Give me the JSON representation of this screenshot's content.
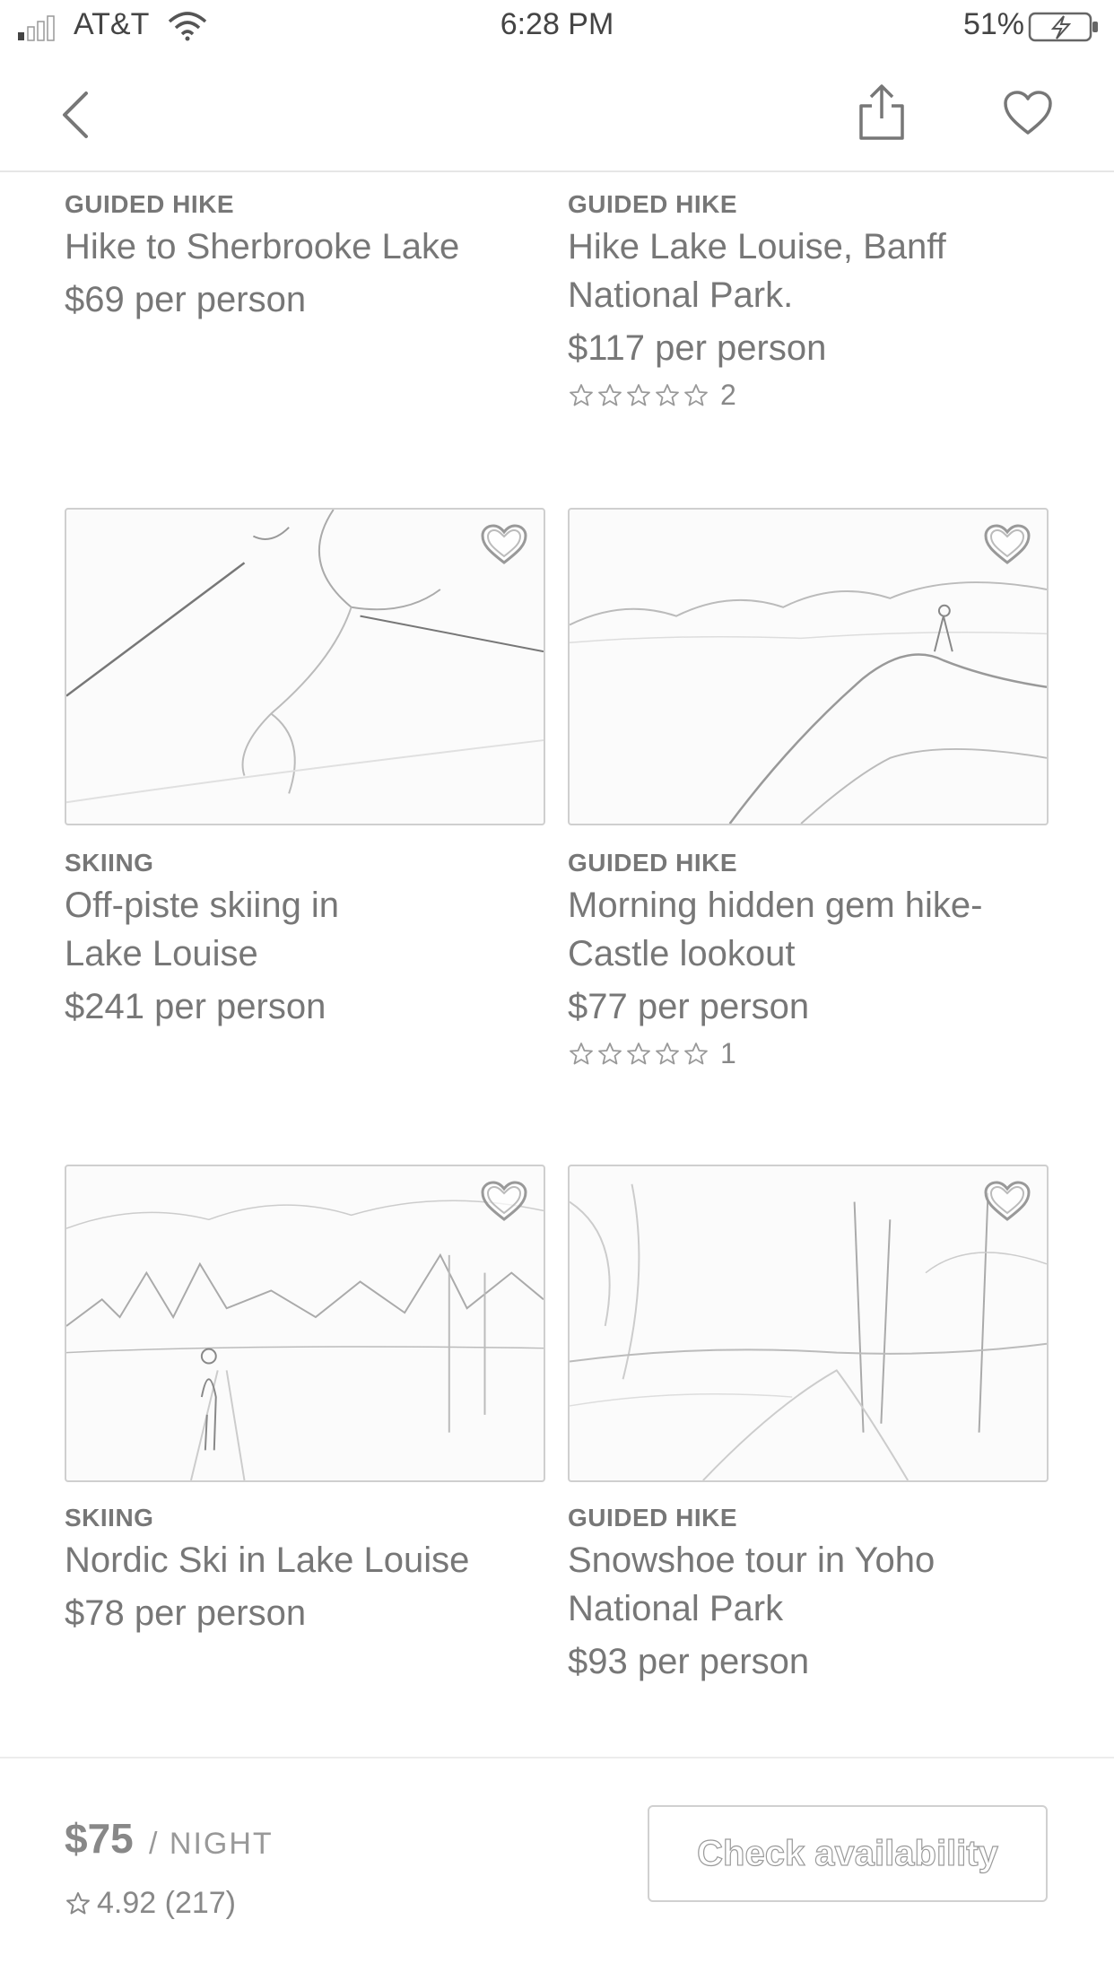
{
  "status_bar": {
    "carrier": "AT&T",
    "time": "6:28 PM",
    "battery": "51%"
  },
  "nav": {
    "icons": [
      "back-chevron-icon",
      "share-icon",
      "heart-icon"
    ]
  },
  "cards": [
    {
      "category": "GUIDED HIKE",
      "title_lines": [
        "Hike to Sherbrooke Lake"
      ],
      "price": "$69 per person"
    },
    {
      "category": "GUIDED HIKE",
      "title_lines": [
        "Hike Lake Louise, Banff",
        "National Park."
      ],
      "price": "$117 per person",
      "rating_count": "2"
    },
    {
      "category": "SKIING",
      "title_lines": [
        "Off-piste skiing in",
        "Lake Louise"
      ],
      "price": "$241 per person"
    },
    {
      "category": "GUIDED HIKE",
      "title_lines": [
        "Morning hidden gem hike-",
        "Castle lookout"
      ],
      "price": "$77 per person",
      "rating_count": "1"
    },
    {
      "category": "SKIING",
      "title_lines": [
        "Nordic Ski in Lake Louise"
      ],
      "price": "$78 per person"
    },
    {
      "category": "GUIDED HIKE",
      "title_lines": [
        "Snowshoe tour in Yoho",
        "National Park"
      ],
      "price": "$93 per person"
    }
  ],
  "bottom_bar": {
    "price": "$75",
    "unit": "/ NIGHT",
    "rating": "4.92 (217)",
    "cta": "Check availability"
  },
  "colors": {
    "text": "#777777",
    "border": "#cfcfcf"
  }
}
